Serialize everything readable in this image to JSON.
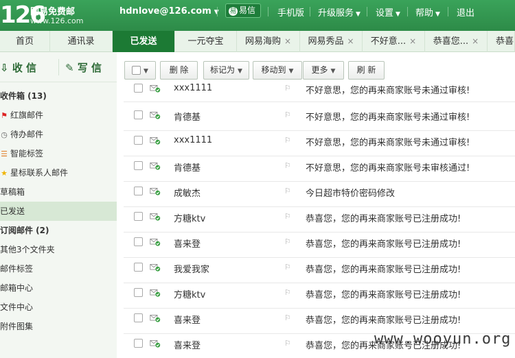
{
  "header": {
    "logo_num": "126",
    "logo_text": "网易免费邮",
    "logo_url": "www.126.com",
    "user": "hdnlove@126.com",
    "yixin": "易信",
    "links": [
      "手机版",
      "升级服务",
      "设置",
      "帮助",
      "退出"
    ]
  },
  "tabs": [
    {
      "label": "首页"
    },
    {
      "label": "通讯录"
    },
    {
      "label": "已发送"
    },
    {
      "label": "一元夺宝"
    },
    {
      "label": "网易海购"
    },
    {
      "label": "网易秀品"
    },
    {
      "label": "不好意..."
    },
    {
      "label": "恭喜您..."
    },
    {
      "label": "恭喜"
    }
  ],
  "sidebar": {
    "receive": "收 信",
    "write": "写 信",
    "items": [
      {
        "label": "收件箱 (13)",
        "icon": ""
      },
      {
        "label": "红旗邮件",
        "icon": "red-flag-icon"
      },
      {
        "label": "待办邮件",
        "icon": "clock-icon"
      },
      {
        "label": "智能标签",
        "icon": "tag-icon"
      },
      {
        "label": "星标联系人邮件",
        "icon": "star-icon"
      },
      {
        "label": "草稿箱",
        "icon": ""
      },
      {
        "label": "已发送",
        "icon": ""
      },
      {
        "label": "订阅邮件 (2)",
        "icon": ""
      },
      {
        "label": "其他3个文件夹",
        "icon": ""
      },
      {
        "label": "邮件标签",
        "icon": ""
      },
      {
        "label": "邮箱中心",
        "icon": ""
      },
      {
        "label": "文件中心",
        "icon": ""
      },
      {
        "label": "附件图集",
        "icon": ""
      }
    ]
  },
  "toolbar": {
    "delete": "删 除",
    "mark": "标记为",
    "move": "移动到",
    "more": "更多",
    "refresh": "刷 新"
  },
  "mails": [
    {
      "sender": "xxx1111",
      "subject": "不好意思，您的再来商家账号未通过审核!"
    },
    {
      "sender": "肯德基",
      "subject": "不好意思，您的再来商家账号未通过审核!"
    },
    {
      "sender": "xxx1111",
      "subject": "不好意思，您的再来商家账号未通过审核!"
    },
    {
      "sender": "肯德基",
      "subject": "不好意思，您的再来商家账号未审核通过!"
    },
    {
      "sender": "成敏杰",
      "subject": "今日超市特价密码修改"
    },
    {
      "sender": "方糖ktv",
      "subject": "恭喜您，您的再来商家账号已注册成功!"
    },
    {
      "sender": "喜来登",
      "subject": "恭喜您，您的再来商家账号已注册成功!"
    },
    {
      "sender": "我爱我家",
      "subject": "恭喜您，您的再来商家账号已注册成功!"
    },
    {
      "sender": "方糖ktv",
      "subject": "恭喜您，您的再来商家账号已注册成功!"
    },
    {
      "sender": "喜来登",
      "subject": "恭喜您，您的再来商家账号已注册成功!"
    },
    {
      "sender": "喜来登",
      "subject": "恭喜您，您的再来商家账号已注册成功!"
    }
  ],
  "watermark": "www.wooyun.org",
  "colors": {
    "header_green": "#2d8b48",
    "active_tab": "#1c7a34",
    "sidebar_bg": "#f3f7f2"
  }
}
